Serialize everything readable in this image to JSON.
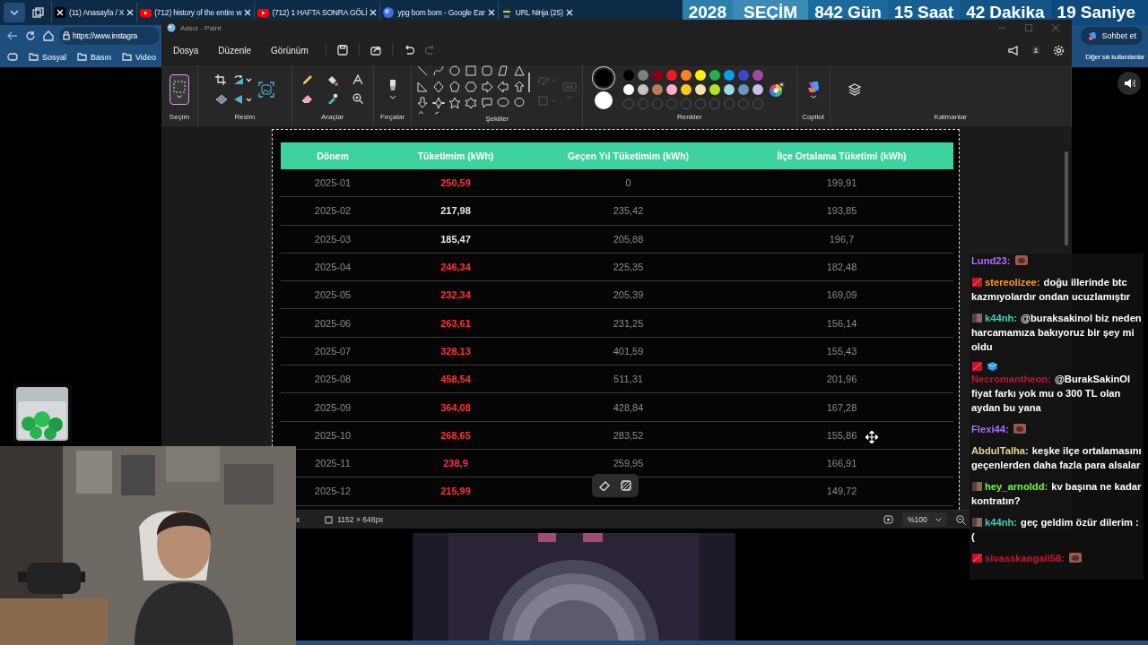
{
  "browser": {
    "tabs": [
      {
        "kind": "x",
        "title": "(11) Anasayfa / X",
        "selected": false
      },
      {
        "kind": "youtube",
        "title": "(712) history of the entire w",
        "selected": false
      },
      {
        "kind": "youtube",
        "title": "(712) 1 HAFTA SONRA GÖLİ",
        "selected": false
      },
      {
        "kind": "globe",
        "title": "ypg bom bom - Google Ear",
        "selected": false
      },
      {
        "kind": "ninja",
        "title": "URL Ninja (25)",
        "selected": false
      }
    ],
    "address": "https://www.instagra",
    "bookmarks": [
      "Sosyal",
      "Basın",
      "Video"
    ],
    "more_bookmarks": "Diğer sık kullanılanlar",
    "copilot_button": "Sohbet et"
  },
  "countdown": {
    "year": "2028",
    "title": "SEÇİM",
    "units": [
      {
        "value": "842",
        "unit": "Gün"
      },
      {
        "value": "15",
        "unit": "Saat"
      },
      {
        "value": "42",
        "unit": "Dakika"
      },
      {
        "value": "19",
        "unit": "Saniye"
      }
    ]
  },
  "paint": {
    "title": "Adsız - Paint",
    "menu": [
      "Dosya",
      "Düzenle",
      "Görünüm"
    ],
    "groups": [
      "Seçim",
      "Resim",
      "Araçlar",
      "Fırçalar",
      "Şekiller",
      "Renkler",
      "Copilot",
      "Katmanlar"
    ],
    "colors": [
      {
        "color": "#000000",
        "selected": true
      },
      {
        "color": "#ffffff",
        "selected": false
      }
    ],
    "palette": [
      {
        "kind": "swatch",
        "color": "#000000"
      },
      {
        "kind": "swatch",
        "color": "#7f7f7f"
      },
      {
        "kind": "swatch",
        "color": "#880015"
      },
      {
        "kind": "swatch",
        "color": "#ed1c24"
      },
      {
        "kind": "swatch",
        "color": "#ff7f27"
      },
      {
        "kind": "swatch",
        "color": "#fff200"
      },
      {
        "kind": "swatch",
        "color": "#22b14c"
      },
      {
        "kind": "swatch",
        "color": "#00a2e8"
      },
      {
        "kind": "swatch",
        "color": "#3f48cc"
      },
      {
        "kind": "swatch",
        "color": "#a349a4"
      },
      {
        "kind": "swatch",
        "color": "#ffffff"
      },
      {
        "kind": "swatch",
        "color": "#c3c3c3"
      },
      {
        "kind": "swatch",
        "color": "#b97a57"
      },
      {
        "kind": "swatch",
        "color": "#ffaec9"
      },
      {
        "kind": "swatch",
        "color": "#ffc90e"
      },
      {
        "kind": "swatch",
        "color": "#efe4b0"
      },
      {
        "kind": "swatch",
        "color": "#b5e61d"
      },
      {
        "kind": "swatch",
        "color": "#99d9ea"
      },
      {
        "kind": "swatch",
        "color": "#7092be"
      },
      {
        "kind": "swatch",
        "color": "#c8bfe7"
      },
      {
        "kind": "empty"
      },
      {
        "kind": "empty"
      },
      {
        "kind": "empty"
      },
      {
        "kind": "empty"
      },
      {
        "kind": "empty"
      },
      {
        "kind": "empty"
      },
      {
        "kind": "empty"
      },
      {
        "kind": "empty"
      },
      {
        "kind": "empty"
      },
      {
        "kind": "empty"
      }
    ],
    "status_fragment": "x",
    "canvas_size": "1152 × 648px",
    "zoom": "%100"
  },
  "canvas_table": {
    "columns": [
      "Dönem",
      "Tüketimim (kWh)",
      "Geçen Yıl Tüketimim (kWh)",
      "İlçe Ortalama Tüketimi (kWh)"
    ],
    "rows": [
      {
        "period": "2025-01",
        "mine": "250,59",
        "high": true,
        "last_year": "0",
        "district": "199,91"
      },
      {
        "period": "2025-02",
        "mine": "217,98",
        "high": false,
        "last_year": "235,42",
        "district": "193,85"
      },
      {
        "period": "2025-03",
        "mine": "185,47",
        "high": false,
        "last_year": "205,88",
        "district": "196,7"
      },
      {
        "period": "2025-04",
        "mine": "246,34",
        "high": true,
        "last_year": "225,35",
        "district": "182,48"
      },
      {
        "period": "2025-05",
        "mine": "232,34",
        "high": true,
        "last_year": "205,39",
        "district": "169,09"
      },
      {
        "period": "2025-06",
        "mine": "263,61",
        "high": true,
        "last_year": "231,25",
        "district": "156,14"
      },
      {
        "period": "2025-07",
        "mine": "328,13",
        "high": true,
        "last_year": "401,59",
        "district": "155,43"
      },
      {
        "period": "2025-08",
        "mine": "458,54",
        "high": true,
        "last_year": "511,31",
        "district": "201,96"
      },
      {
        "period": "2025-09",
        "mine": "364,08",
        "high": true,
        "last_year": "428,84",
        "district": "167,28"
      },
      {
        "period": "2025-10",
        "mine": "268,65",
        "high": true,
        "last_year": "283,52",
        "district": "155,86"
      },
      {
        "period": "2025-11",
        "mine": "238,9",
        "high": true,
        "last_year": "259,95",
        "district": "166,91"
      },
      {
        "period": "2025-12",
        "mine": "215,99",
        "high": true,
        "district": "149,72"
      }
    ]
  },
  "chat": [
    {
      "user": "Lund23:",
      "color": "#a970ff",
      "emote": true
    },
    {
      "user": "stereolizee:",
      "color": "#ff9a1f",
      "badges": [
        {
          "kind": "red"
        }
      ],
      "text": "doğu illerinde btc kazmıyolardır ondan ucuzlamıştır"
    },
    {
      "user": "k44nh:",
      "color": "#3fd1b0",
      "badges": [
        {
          "kind": "avatar"
        }
      ],
      "text": "@buraksakinol biz neden harcamamıza bakıyoruz bir şey mi oldu"
    },
    {
      "user": "Necromantheon:",
      "color": "#c0143c",
      "badges": [
        {
          "kind": "red"
        },
        {
          "kind": "cube"
        }
      ],
      "block": true,
      "text": "@BurakSakinOl fiyat farkı yok mu o 300 TL olan aydan bu yana"
    },
    {
      "user": "Flexi44:",
      "color": "#a970ff",
      "emote": true
    },
    {
      "user": "AbdulTalha:",
      "color": "#e8d48a",
      "text": "keşke ilçe ortalamasını geçenlerden daha fazla para alsalar"
    },
    {
      "user": "hey_arnoldd:",
      "color": "#6bff3a",
      "badges": [
        {
          "kind": "avatar"
        }
      ],
      "text": "kv başına ne kadar kontratın?"
    },
    {
      "user": "k44nh:",
      "color": "#3fd1b0",
      "badges": [
        {
          "kind": "avatar"
        }
      ],
      "text": "geç geldim özür dilerim :("
    },
    {
      "user": "sivasskangali58:",
      "color": "#d0142c",
      "badges": [
        {
          "kind": "red"
        }
      ],
      "emote": true
    }
  ]
}
